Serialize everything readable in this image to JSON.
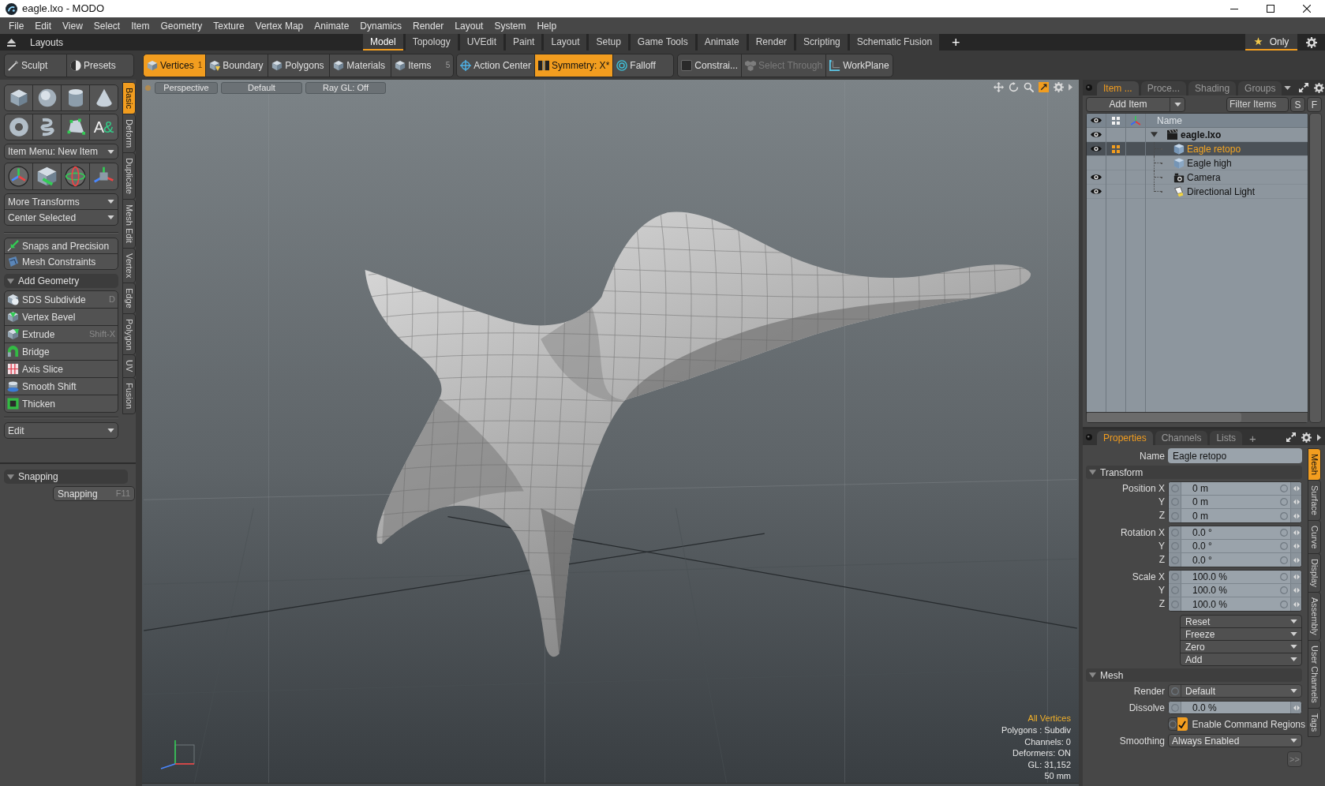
{
  "window": {
    "title": "eagle.lxo - MODO"
  },
  "menu_bar": [
    "File",
    "Edit",
    "View",
    "Select",
    "Item",
    "Geometry",
    "Texture",
    "Vertex Map",
    "Animate",
    "Dynamics",
    "Render",
    "Layout",
    "System",
    "Help"
  ],
  "layouts_bar": {
    "label": "Layouts",
    "tabs": [
      {
        "label": "Model",
        "selected": true
      },
      {
        "label": "Topology",
        "selected": false
      },
      {
        "label": "UVEdit",
        "selected": false
      },
      {
        "label": "Paint",
        "selected": false
      },
      {
        "label": "Layout",
        "selected": false
      },
      {
        "label": "Setup",
        "selected": false
      },
      {
        "label": "Game Tools",
        "selected": false
      },
      {
        "label": "Animate",
        "selected": false
      },
      {
        "label": "Render",
        "selected": false
      },
      {
        "label": "Scripting",
        "selected": false
      },
      {
        "label": "Schematic Fusion",
        "selected": false
      }
    ],
    "add_button": "+",
    "only_toggle": {
      "label": "Only",
      "on": true
    }
  },
  "toolbar": {
    "brushes": [
      {
        "label": "Sculpt",
        "kind": "sculpt"
      },
      {
        "label": "Presets",
        "kind": "presets"
      }
    ],
    "selection_modes": [
      {
        "label": "Vertices",
        "count": "1",
        "kind": "vertices",
        "selected": true
      },
      {
        "label": "Boundary",
        "kind": "boundary",
        "selected": false
      },
      {
        "label": "Polygons",
        "kind": "polygons",
        "selected": false
      },
      {
        "label": "Materials",
        "kind": "materials",
        "selected": false
      },
      {
        "label": "Items",
        "count": "5",
        "kind": "items",
        "selected": false
      }
    ],
    "modifiers": [
      {
        "label": "Action Center",
        "kind": "action_center",
        "on": false
      },
      {
        "label": "Symmetry: X*",
        "kind": "symmetry",
        "on": true
      },
      {
        "label": "Falloff",
        "kind": "falloff",
        "on": false
      }
    ],
    "options": [
      {
        "label": "Constrai...",
        "kind": "constraint",
        "disabled": false
      },
      {
        "label": "Select Through",
        "kind": "select_through",
        "disabled": true
      },
      {
        "label": "WorkPlane",
        "kind": "workplane",
        "disabled": false
      }
    ]
  },
  "left_panel": {
    "text_tool": [
      "A",
      "&"
    ],
    "item_menu": "Item Menu: New Item",
    "transform_menus": [
      "More Transforms",
      "Center Selected"
    ],
    "tools": [
      {
        "label": "Snaps and Precision",
        "kind": "snaps"
      },
      {
        "label": "Mesh Constraints",
        "kind": "constraints"
      }
    ],
    "add_geometry": {
      "label": "Add Geometry",
      "expanded": true,
      "items": [
        {
          "label": "SDS Subdivide",
          "shortcut": "D",
          "kind": "subdivide"
        },
        {
          "label": "Vertex Bevel",
          "kind": "bevel"
        },
        {
          "label": "Extrude",
          "shortcut": "Shift-X",
          "kind": "extrude"
        },
        {
          "label": "Bridge",
          "kind": "bridge"
        },
        {
          "label": "Axis Slice",
          "kind": "slice"
        },
        {
          "label": "Smooth Shift",
          "kind": "shift"
        },
        {
          "label": "Thicken",
          "kind": "thicken"
        }
      ]
    },
    "edit_menu": "Edit",
    "tabs": [
      {
        "label": "Basic",
        "selected": true
      },
      {
        "label": "Deform",
        "selected": false
      },
      {
        "label": "Duplicate",
        "selected": false
      },
      {
        "label": "Mesh Edit",
        "selected": false
      },
      {
        "label": "Vertex",
        "selected": false
      },
      {
        "label": "Edge",
        "selected": false
      },
      {
        "label": "Polygon",
        "selected": false
      },
      {
        "label": "UV",
        "selected": false
      },
      {
        "label": "Fusion",
        "selected": false
      }
    ],
    "snapping": {
      "label": "Snapping",
      "expanded": true,
      "button": {
        "label": "Snapping",
        "shortcut": "F11"
      }
    }
  },
  "viewport": {
    "buttons": [
      "Perspective",
      "Default",
      "Ray GL: Off"
    ],
    "stats": [
      {
        "text": "All Vertices",
        "kind": "selection"
      },
      {
        "text": "Polygons : Subdiv",
        "kind": "info"
      },
      {
        "text": "Channels: 0",
        "kind": "info"
      },
      {
        "text": "Deformers: ON",
        "kind": "info"
      },
      {
        "text": "GL: 31,152",
        "kind": "info"
      },
      {
        "text": "50 mm",
        "kind": "info"
      }
    ]
  },
  "items_panel": {
    "tabs": [
      {
        "label": "Item ...",
        "selected": true
      },
      {
        "label": "Proce...",
        "selected": false
      },
      {
        "label": "Shading",
        "selected": false
      },
      {
        "label": "Groups",
        "selected": false
      }
    ],
    "add_item": "Add Item",
    "filter": {
      "placeholder": "Filter Items"
    },
    "buttons": [
      "S",
      "F"
    ],
    "name_column": "Name",
    "tree": [
      {
        "label": "eagle.lxo",
        "kind": "scene",
        "visible": true,
        "active": false,
        "selected": false,
        "expanded": true,
        "children": [
          {
            "label": "Eagle retopo",
            "kind": "mesh",
            "visible": true,
            "active": true,
            "selected": true
          },
          {
            "label": "Eagle high",
            "kind": "mesh",
            "visible": false,
            "active": false,
            "selected": false
          },
          {
            "label": "Camera",
            "kind": "camera",
            "visible": true,
            "active": false,
            "selected": false
          },
          {
            "label": "Directional Light",
            "kind": "light",
            "visible": true,
            "active": false,
            "selected": false
          }
        ]
      }
    ]
  },
  "properties_panel": {
    "tabs": [
      {
        "label": "Properties",
        "selected": true
      },
      {
        "label": "Channels",
        "selected": false
      },
      {
        "label": "Lists",
        "selected": false
      }
    ],
    "add_tab": "+",
    "name": {
      "label": "Name",
      "value": "Eagle retopo"
    },
    "transform": {
      "label": "Transform",
      "expanded": true,
      "groups": [
        [
          {
            "label": "Position X",
            "value": "0 m"
          },
          {
            "label": "Y",
            "value": "0 m"
          },
          {
            "label": "Z",
            "value": "0 m"
          }
        ],
        [
          {
            "label": "Rotation X",
            "value": "0.0 °"
          },
          {
            "label": "Y",
            "value": "0.0 °"
          },
          {
            "label": "Z",
            "value": "0.0 °"
          }
        ],
        [
          {
            "label": "Scale X",
            "value": "100.0 %"
          },
          {
            "label": "Y",
            "value": "100.0 %"
          },
          {
            "label": "Z",
            "value": "100.0 %"
          }
        ]
      ],
      "actions": [
        "Reset",
        "Freeze",
        "Zero",
        "Add"
      ]
    },
    "mesh": {
      "label": "Mesh",
      "expanded": true,
      "render": {
        "label": "Render",
        "value": "Default"
      },
      "dissolve": {
        "label": "Dissolve",
        "value": "0.0 %"
      },
      "command_regions": {
        "label": "Enable Command Regions",
        "checked": true
      },
      "smoothing": {
        "label": "Smoothing",
        "value": "Always Enabled"
      },
      "more_button": ">>"
    },
    "side_tabs": [
      {
        "label": "Mesh",
        "selected": true
      },
      {
        "label": "Surface",
        "selected": false
      },
      {
        "label": "Curve",
        "selected": false
      },
      {
        "label": "Display",
        "selected": false
      },
      {
        "label": "Assembly",
        "selected": false
      },
      {
        "label": "User Channels",
        "selected": false
      },
      {
        "label": "Tags",
        "selected": false
      }
    ]
  }
}
